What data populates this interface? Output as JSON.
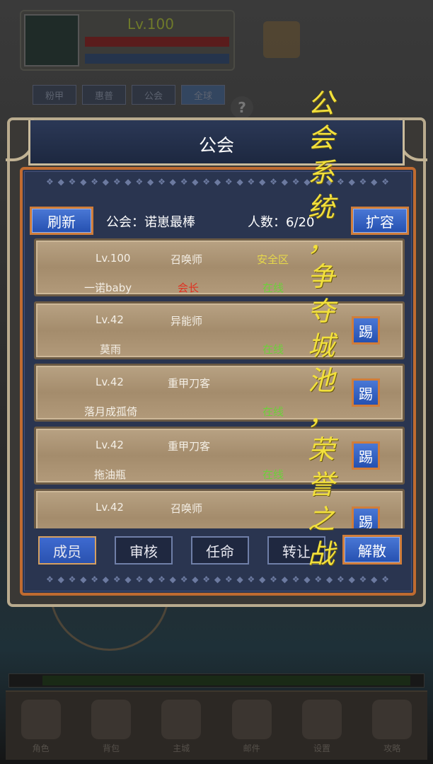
{
  "background": {
    "level": "Lv.100",
    "tabs": [
      "粉甲",
      "惠普",
      "公会",
      "全球"
    ],
    "help": "?",
    "nav": [
      "角色",
      "背包",
      "主城",
      "邮件",
      "设置",
      "攻略"
    ]
  },
  "dialog": {
    "title": "公会",
    "refresh_label": "刷新",
    "guild_label": "公会：诺崽最棒",
    "count_label": "人数：6/20",
    "expand_label": "扩容",
    "kick_label": "踢",
    "members": [
      {
        "level": "Lv.100",
        "class": "召唤师",
        "location": "安全区",
        "name": "一诺baby",
        "rank": "会长",
        "status": "在线",
        "kickable": false
      },
      {
        "level": "Lv.42",
        "class": "异能师",
        "location": "",
        "name": "莫雨",
        "rank": "",
        "status": "在线",
        "kickable": true
      },
      {
        "level": "Lv.42",
        "class": "重甲刀客",
        "location": "",
        "name": "落月成孤倚",
        "rank": "",
        "status": "在线",
        "kickable": true
      },
      {
        "level": "Lv.42",
        "class": "重甲刀客",
        "location": "",
        "name": "拖油瓶",
        "rank": "",
        "status": "在线",
        "kickable": true
      },
      {
        "level": "Lv.42",
        "class": "召唤师",
        "location": "",
        "name": "",
        "rank": "",
        "status": "",
        "kickable": true
      }
    ],
    "tabs": {
      "members": "成员",
      "review": "审核",
      "appoint": "任命",
      "transfer": "转让",
      "disband": "解散"
    }
  },
  "promo_text": [
    "公",
    "会",
    "系",
    "统",
    "，",
    "争",
    "夺",
    "城",
    "池",
    "，",
    "荣",
    "誉",
    "之",
    "战"
  ],
  "colors": {
    "title_bg": "#1d2840",
    "panel_border": "#c06b30",
    "button_blue": "#2550b0",
    "row_wood": "#a48c6c",
    "rank_red": "#e03020",
    "online_green": "#6cd03a",
    "location_yellow": "#e6d84a",
    "promo_yellow": "#f2e03c"
  }
}
